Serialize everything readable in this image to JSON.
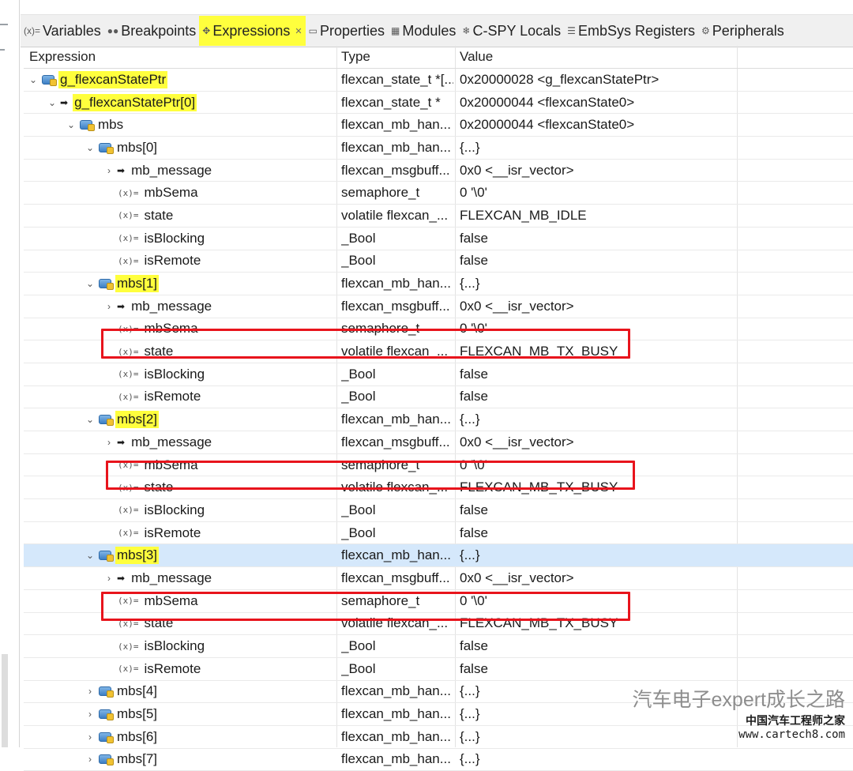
{
  "tabs": [
    {
      "id": "variables",
      "icon": "(x)=",
      "label": "Variables",
      "active": false
    },
    {
      "id": "breakpoints",
      "icon": "●●",
      "label": "Breakpoints",
      "active": false
    },
    {
      "id": "expressions",
      "icon": "✥",
      "label": "Expressions",
      "active": true,
      "close": "✕"
    },
    {
      "id": "properties",
      "icon": "▭",
      "label": "Properties",
      "active": false
    },
    {
      "id": "modules",
      "icon": "▦",
      "label": "Modules",
      "active": false
    },
    {
      "id": "cspy-locals",
      "icon": "❄",
      "label": "C-SPY Locals",
      "active": false
    },
    {
      "id": "embsys-registers",
      "icon": "☰",
      "label": "EmbSys Registers",
      "active": false
    },
    {
      "id": "peripherals",
      "icon": "⚙",
      "label": "Peripherals",
      "active": false
    }
  ],
  "columns": {
    "expression": "Expression",
    "type": "Type",
    "value": "Value"
  },
  "rows": [
    {
      "indent": 0,
      "chev": "⌄",
      "icon": "ptr",
      "name": "g_flexcanStatePtr",
      "type": "flexcan_state_t *[...",
      "value": "0x20000028 <g_flexcanStatePtr>",
      "hl": true
    },
    {
      "indent": 1,
      "chev": "⌄",
      "icon": "arrow",
      "name": "g_flexcanStatePtr[0]",
      "type": "flexcan_state_t *",
      "value": "0x20000044 <flexcanState0>",
      "hl": true
    },
    {
      "indent": 2,
      "chev": "⌄",
      "icon": "ptr",
      "name": "mbs",
      "type": "flexcan_mb_han...",
      "value": "0x20000044 <flexcanState0>"
    },
    {
      "indent": 3,
      "chev": "⌄",
      "icon": "ptr",
      "name": "mbs[0]",
      "type": "flexcan_mb_han...",
      "value": "{...}"
    },
    {
      "indent": 4,
      "chev": "›",
      "icon": "arrow",
      "name": "mb_message",
      "type": "flexcan_msgbuff...",
      "value": "0x0 <__isr_vector>"
    },
    {
      "indent": 4,
      "chev": "",
      "icon": "var",
      "name": "mbSema",
      "type": "semaphore_t",
      "value": "0 '\\0'"
    },
    {
      "indent": 4,
      "chev": "",
      "icon": "var",
      "name": "state",
      "type": "volatile flexcan_...",
      "value": "FLEXCAN_MB_IDLE"
    },
    {
      "indent": 4,
      "chev": "",
      "icon": "var",
      "name": "isBlocking",
      "type": "_Bool",
      "value": "false"
    },
    {
      "indent": 4,
      "chev": "",
      "icon": "var",
      "name": "isRemote",
      "type": "_Bool",
      "value": "false"
    },
    {
      "indent": 3,
      "chev": "⌄",
      "icon": "ptr",
      "name": "mbs[1]",
      "type": "flexcan_mb_han...",
      "value": "{...}",
      "hl": true
    },
    {
      "indent": 4,
      "chev": "›",
      "icon": "arrow",
      "name": "mb_message",
      "type": "flexcan_msgbuff...",
      "value": "0x0 <__isr_vector>"
    },
    {
      "indent": 4,
      "chev": "",
      "icon": "var",
      "name": "mbSema",
      "type": "semaphore_t",
      "value": "0 '\\0'"
    },
    {
      "indent": 4,
      "chev": "",
      "icon": "var",
      "name": "state",
      "type": "volatile flexcan_...",
      "value": "FLEXCAN_MB_TX_BUSY",
      "boxed": true
    },
    {
      "indent": 4,
      "chev": "",
      "icon": "var",
      "name": "isBlocking",
      "type": "_Bool",
      "value": "false"
    },
    {
      "indent": 4,
      "chev": "",
      "icon": "var",
      "name": "isRemote",
      "type": "_Bool",
      "value": "false"
    },
    {
      "indent": 3,
      "chev": "⌄",
      "icon": "ptr",
      "name": "mbs[2]",
      "type": "flexcan_mb_han...",
      "value": "{...}",
      "hl": true
    },
    {
      "indent": 4,
      "chev": "›",
      "icon": "arrow",
      "name": "mb_message",
      "type": "flexcan_msgbuff...",
      "value": "0x0 <__isr_vector>"
    },
    {
      "indent": 4,
      "chev": "",
      "icon": "var",
      "name": "mbSema",
      "type": "semaphore_t",
      "value": "0 '\\0'"
    },
    {
      "indent": 4,
      "chev": "",
      "icon": "var",
      "name": "state",
      "type": "volatile flexcan_...",
      "value": "FLEXCAN_MB_TX_BUSY",
      "boxed": true
    },
    {
      "indent": 4,
      "chev": "",
      "icon": "var",
      "name": "isBlocking",
      "type": "_Bool",
      "value": "false"
    },
    {
      "indent": 4,
      "chev": "",
      "icon": "var",
      "name": "isRemote",
      "type": "_Bool",
      "value": "false"
    },
    {
      "indent": 3,
      "chev": "⌄",
      "icon": "ptr",
      "name": "mbs[3]",
      "type": "flexcan_mb_han...",
      "value": "{...}",
      "hl": true,
      "selected": true
    },
    {
      "indent": 4,
      "chev": "›",
      "icon": "arrow",
      "name": "mb_message",
      "type": "flexcan_msgbuff...",
      "value": "0x0 <__isr_vector>"
    },
    {
      "indent": 4,
      "chev": "",
      "icon": "var",
      "name": "mbSema",
      "type": "semaphore_t",
      "value": "0 '\\0'"
    },
    {
      "indent": 4,
      "chev": "",
      "icon": "var",
      "name": "state",
      "type": "volatile flexcan_...",
      "value": "FLEXCAN_MB_TX_BUSY",
      "boxed": true
    },
    {
      "indent": 4,
      "chev": "",
      "icon": "var",
      "name": "isBlocking",
      "type": "_Bool",
      "value": "false"
    },
    {
      "indent": 4,
      "chev": "",
      "icon": "var",
      "name": "isRemote",
      "type": "_Bool",
      "value": "false"
    },
    {
      "indent": 3,
      "chev": "›",
      "icon": "ptr",
      "name": "mbs[4]",
      "type": "flexcan_mb_han...",
      "value": "{...}"
    },
    {
      "indent": 3,
      "chev": "›",
      "icon": "ptr",
      "name": "mbs[5]",
      "type": "flexcan_mb_han...",
      "value": "{...}"
    },
    {
      "indent": 3,
      "chev": "›",
      "icon": "ptr",
      "name": "mbs[6]",
      "type": "flexcan_mb_han...",
      "value": "{...}"
    },
    {
      "indent": 3,
      "chev": "›",
      "icon": "ptr",
      "name": "mbs[7]",
      "type": "flexcan_mb_han...",
      "value": "{...}"
    }
  ],
  "watermark": {
    "main": "汽车电子expert成长之路",
    "sub1": "中国汽车工程师之家",
    "sub2": "www.cartech8.com"
  },
  "colors": {
    "highlight": "#ffff3d",
    "redbox": "#e8141c",
    "selected_row": "#d5e8fb"
  }
}
